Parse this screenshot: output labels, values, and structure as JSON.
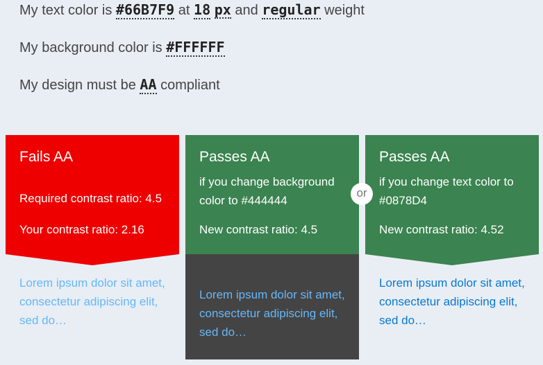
{
  "form": {
    "text_prefix": "My text color is",
    "text_color": "#66B7F9",
    "at": "at",
    "size": "18",
    "size_unit": "px",
    "and": "and",
    "weight": "regular",
    "weight_suffix": "weight",
    "bg_prefix": "My background color is",
    "bg_color": "#FFFFFF",
    "design_prefix": "My design must be",
    "level": "AA",
    "design_suffix": "compliant"
  },
  "cards": [
    {
      "title": "Fails AA",
      "required": "Required contrast ratio: 4.5",
      "ratio": "Your contrast ratio: 2.16",
      "sample": "Lorem ipsum dolor sit amet, consectetur adipiscing elit, sed do…",
      "color": "#ee0000"
    },
    {
      "title": "Passes AA",
      "subtitle": "if you change background color to #444444",
      "ratio": "New contrast ratio: 4.5",
      "sample": "Lorem ipsum dolor sit amet, consectetur adipiscing elit, sed do…",
      "color": "#3b8350"
    },
    {
      "title": "Passes AA",
      "subtitle": "if you change text color to #0878D4",
      "ratio": "New contrast ratio: 4.52",
      "sample": "Lorem ipsum dolor sit amet, consectetur adipiscing elit, sed do…",
      "color": "#3b8350"
    }
  ],
  "or_label": "or"
}
